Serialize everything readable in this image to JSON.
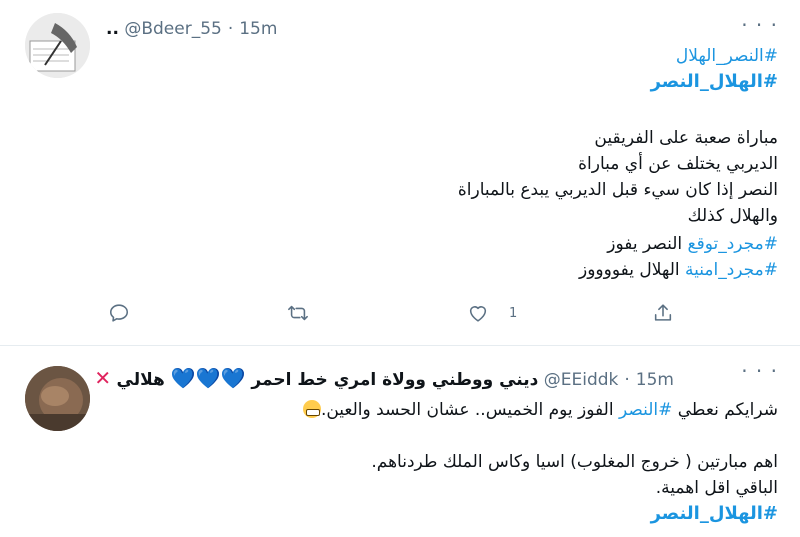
{
  "tweet1": {
    "handle": "@Bdeer_55",
    "name_prefix": "..",
    "time": "15m",
    "hashtags": [
      "#النصر_الهلال",
      "#الهلال_النصر"
    ],
    "lines": [
      "مباراة صعبة على الفريقين",
      "الديربي يختلف عن أي مباراة",
      "النصر إذا كان سيء قبل الديربي يبدع بالمباراة",
      "والهلال كذلك"
    ],
    "tag_line1": {
      "tag": "#مجرد_توقع",
      "text": " النصر يفوز"
    },
    "tag_line2": {
      "tag": "#مجرد_امنية",
      "text": " الهلال يفووووز"
    },
    "actions": {
      "reply_count": "",
      "retweet_count": "",
      "like_count": "1",
      "share_count": ""
    }
  },
  "tweet2": {
    "display_name": "هلالي 💙💙💙 ديني ووطني وولاة امري خط احمر ❌",
    "name_text": "هلالي",
    "name_tail": "ديني ووطني وولاة امري خط احمر",
    "handle": "@EEiddk",
    "time": "15m",
    "line1_pre": "شرايكم نعطي ",
    "line1_tag": "#النصر",
    "line1_post": " الفوز يوم الخميس.. عشان الحسد والعين.",
    "line2": "اهم مبارتين ( خروج المغلوب) اسيا وكاس الملك طردناهم.",
    "line3": "الباقي اقل اهمية.",
    "bottom_tag": "#الهلال_النصر"
  },
  "colors": {
    "link": "#1b95e0",
    "muted": "#5b7083",
    "text": "#0f1419"
  }
}
